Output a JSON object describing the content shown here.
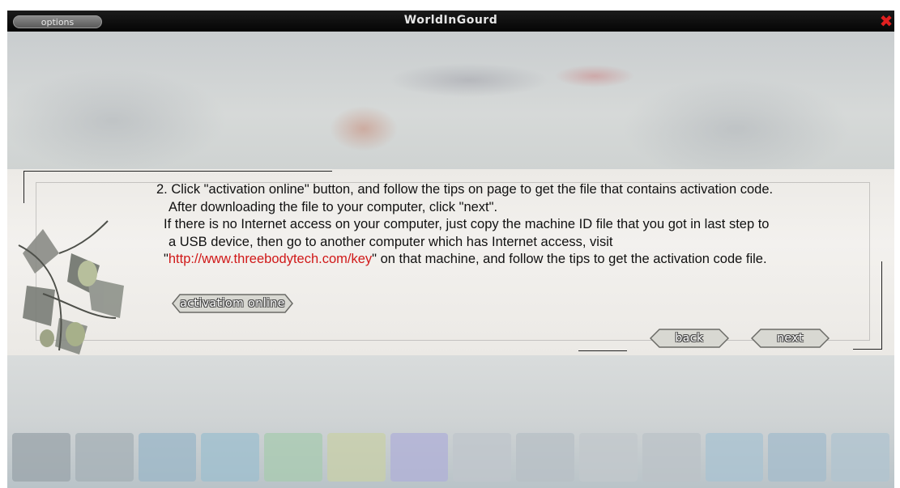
{
  "window": {
    "title": "WorldInGourd",
    "options_label": "options",
    "close_glyph": "✖"
  },
  "instructions": {
    "line1": "2. Click \"activation online\" button, and follow the tips on page to get the file that contains activation code.",
    "line2": "After downloading the file to your computer, click \"next\".",
    "line3": "If there is no Internet access on your computer, just copy the machine ID file that you got in last step to",
    "line4": "a USB device, then go to another computer which has Internet access, visit",
    "line5_quote_open": "\"",
    "line5_url": "http://www.threebodytech.com/key",
    "line5_rest": "\" on that machine, and follow the tips to get the activation code file."
  },
  "buttons": {
    "activation_online": "activatiom online",
    "back": "back",
    "next": "next"
  },
  "colors": {
    "url": "#d01818",
    "close": "#e02020"
  },
  "icons": {
    "close": "close-icon",
    "decoration": "gourd-plant-illustration"
  }
}
